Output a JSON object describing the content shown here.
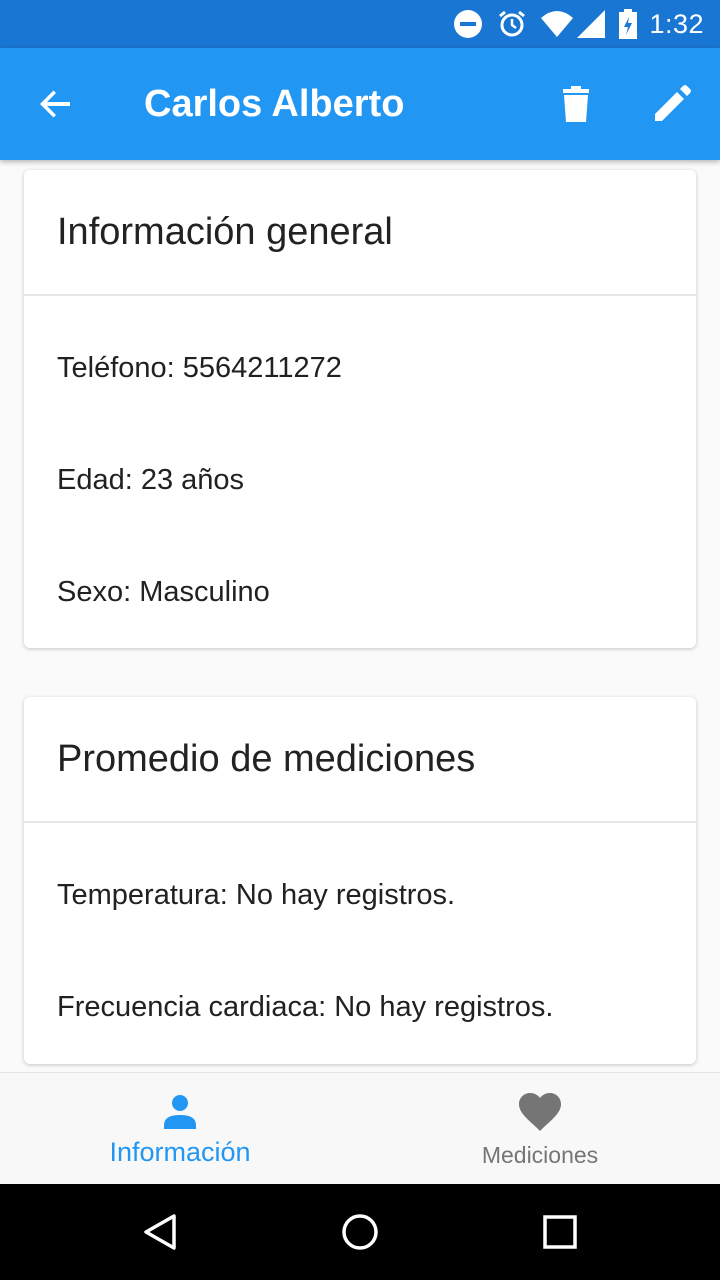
{
  "status_bar": {
    "time": "1:32",
    "icons": [
      "do-not-disturb-icon",
      "alarm-icon",
      "wifi-icon",
      "signal-icon",
      "battery-icon"
    ]
  },
  "app_bar": {
    "title": "Carlos Alberto",
    "icons": [
      "arrow-back-icon",
      "delete-icon",
      "edit-icon"
    ],
    "color": "#2196f3"
  },
  "general_card": {
    "title": "Información general",
    "phone": "Teléfono: 5564211272",
    "age": "Edad: 23 años",
    "sex": "Sexo: Masculino"
  },
  "averages_card": {
    "title": "Promedio de mediciones",
    "temperature": "Temperatura: No hay registros.",
    "heart_rate": "Frecuencia cardiaca: No hay registros."
  },
  "bottom_nav": {
    "items": [
      {
        "label": "Información",
        "icon": "person-icon",
        "active": true
      },
      {
        "label": "Mediciones",
        "icon": "heart-icon",
        "active": false
      }
    ],
    "active_color": "#2196f3",
    "inactive_color": "#757575"
  },
  "system_nav": {
    "icons": [
      "back-triangle-icon",
      "home-circle-icon",
      "recents-square-icon"
    ]
  }
}
